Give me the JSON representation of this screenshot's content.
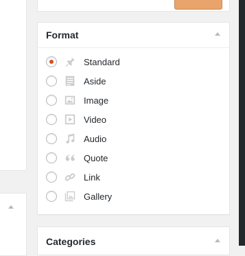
{
  "format_box": {
    "title": "Format",
    "options": [
      {
        "label": "Standard",
        "icon": "pin-icon",
        "checked": true
      },
      {
        "label": "Aside",
        "icon": "aside-icon",
        "checked": false
      },
      {
        "label": "Image",
        "icon": "image-icon",
        "checked": false
      },
      {
        "label": "Video",
        "icon": "video-icon",
        "checked": false
      },
      {
        "label": "Audio",
        "icon": "audio-icon",
        "checked": false
      },
      {
        "label": "Quote",
        "icon": "quote-icon",
        "checked": false
      },
      {
        "label": "Link",
        "icon": "link-icon",
        "checked": false
      },
      {
        "label": "Gallery",
        "icon": "gallery-icon",
        "checked": false
      }
    ]
  },
  "categories_box": {
    "title": "Categories"
  },
  "colors": {
    "radio_checked": "#d54e21",
    "icon": "#cccccc",
    "button": "#e8a46a"
  }
}
